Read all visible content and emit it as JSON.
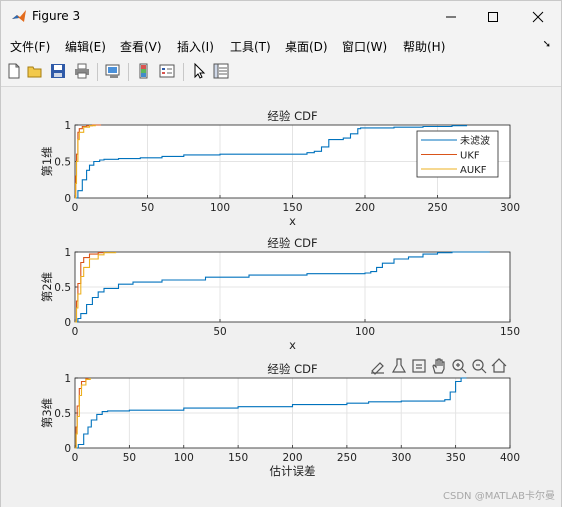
{
  "window": {
    "title": "Figure 3"
  },
  "menu": [
    "文件(F)",
    "编辑(E)",
    "查看(V)",
    "插入(I)",
    "工具(T)",
    "桌面(D)",
    "窗口(W)",
    "帮助(H)"
  ],
  "toolbar_icons": [
    "new-figure-icon",
    "open-file-icon",
    "save-icon",
    "print-icon",
    "link-plot-icon",
    "colorbar-icon",
    "legend-icon",
    "pointer-icon",
    "property-inspector-icon"
  ],
  "axes_toolbar_icons": [
    "brush-icon",
    "data-tips-icon",
    "restore-view-icon",
    "pan-icon",
    "zoom-in-icon",
    "zoom-out-icon",
    "home-icon"
  ],
  "colors": {
    "series1": "#0072BD",
    "series2": "#D95319",
    "series3": "#EDB120"
  },
  "watermark": "CSDN @MATLAB卡尔曼",
  "chart_data": [
    {
      "type": "line",
      "title": "经验 CDF",
      "xlabel": "x",
      "ylabel": "第1维",
      "xlim": [
        0,
        300
      ],
      "ylim": [
        0,
        1
      ],
      "xticks": [
        "0",
        "50",
        "100",
        "150",
        "200",
        "250",
        "300"
      ],
      "yticks": [
        "0",
        "0.5",
        "1"
      ],
      "grid": true,
      "legend": {
        "entries": [
          "未滤波",
          "UKF",
          "AUKF"
        ],
        "placement": "top-right"
      },
      "series": [
        {
          "name": "未滤波",
          "x": [
            0,
            2,
            5,
            8,
            10,
            13,
            17,
            20,
            30,
            45,
            60,
            75,
            100,
            130,
            160,
            165,
            170,
            175,
            180,
            185,
            190,
            195,
            197,
            200,
            220,
            240,
            260,
            270
          ],
          "y": [
            0,
            0.1,
            0.25,
            0.38,
            0.45,
            0.5,
            0.52,
            0.53,
            0.54,
            0.55,
            0.57,
            0.59,
            0.6,
            0.6,
            0.62,
            0.64,
            0.7,
            0.8,
            0.8,
            0.82,
            0.88,
            0.95,
            0.96,
            0.96,
            0.97,
            0.98,
            0.99,
            1.0
          ]
        },
        {
          "name": "UKF",
          "x": [
            0,
            0.5,
            1,
            2,
            3,
            5,
            8,
            12,
            18
          ],
          "y": [
            0,
            0.3,
            0.6,
            0.9,
            0.95,
            0.98,
            0.99,
            1.0,
            1.0
          ]
        },
        {
          "name": "AUKF",
          "x": [
            0,
            0.5,
            1,
            2,
            3,
            6,
            10,
            14
          ],
          "y": [
            0,
            0.2,
            0.5,
            0.8,
            0.9,
            0.97,
            0.99,
            1.0
          ]
        }
      ]
    },
    {
      "type": "line",
      "title": "经验 CDF",
      "xlabel": "x",
      "ylabel": "第2维",
      "xlim": [
        0,
        150
      ],
      "ylim": [
        0,
        1
      ],
      "xticks": [
        "0",
        "50",
        "100",
        "150"
      ],
      "yticks": [
        "0",
        "0.5",
        "1"
      ],
      "grid": true,
      "series": [
        {
          "name": "未滤波",
          "x": [
            0,
            1,
            2,
            4,
            6,
            8,
            10,
            15,
            20,
            30,
            45,
            60,
            80,
            100,
            102,
            104,
            106,
            110,
            115,
            120,
            125,
            130,
            140,
            143
          ],
          "y": [
            0,
            0.05,
            0.12,
            0.25,
            0.35,
            0.43,
            0.48,
            0.54,
            0.57,
            0.6,
            0.64,
            0.67,
            0.69,
            0.7,
            0.72,
            0.78,
            0.84,
            0.9,
            0.93,
            0.97,
            0.99,
            1.0,
            1.0,
            1.0
          ]
        },
        {
          "name": "UKF",
          "x": [
            0,
            0.5,
            1,
            2,
            3,
            5,
            8,
            10
          ],
          "y": [
            0,
            0.3,
            0.55,
            0.85,
            0.92,
            0.97,
            0.99,
            1.0
          ]
        },
        {
          "name": "AUKF",
          "x": [
            0,
            0.5,
            1,
            2,
            3,
            5,
            8,
            10,
            14
          ],
          "y": [
            0,
            0.2,
            0.4,
            0.65,
            0.78,
            0.9,
            0.96,
            0.99,
            1.0
          ]
        }
      ]
    },
    {
      "type": "line",
      "title": "经验 CDF",
      "xlabel": "估计误差",
      "ylabel": "第3维",
      "xlim": [
        0,
        400
      ],
      "ylim": [
        0,
        1
      ],
      "xticks": [
        "0",
        "50",
        "100",
        "150",
        "200",
        "250",
        "300",
        "350",
        "400"
      ],
      "yticks": [
        "0",
        "0.5",
        "1"
      ],
      "grid": true,
      "series": [
        {
          "name": "未滤波",
          "x": [
            0,
            3,
            8,
            12,
            15,
            20,
            25,
            30,
            50,
            100,
            150,
            200,
            250,
            270,
            300,
            340,
            345,
            350,
            355,
            360
          ],
          "y": [
            0,
            0.05,
            0.2,
            0.3,
            0.4,
            0.48,
            0.52,
            0.53,
            0.54,
            0.57,
            0.59,
            0.62,
            0.64,
            0.66,
            0.67,
            0.69,
            0.8,
            0.95,
            1.0,
            1.0
          ]
        },
        {
          "name": "UKF",
          "x": [
            0,
            1,
            2,
            4,
            6,
            10,
            12
          ],
          "y": [
            0,
            0.3,
            0.6,
            0.85,
            0.95,
            0.99,
            1.0
          ]
        },
        {
          "name": "AUKF",
          "x": [
            0,
            1,
            2,
            4,
            6,
            10,
            14
          ],
          "y": [
            0,
            0.2,
            0.45,
            0.75,
            0.9,
            0.98,
            1.0
          ]
        }
      ]
    }
  ]
}
